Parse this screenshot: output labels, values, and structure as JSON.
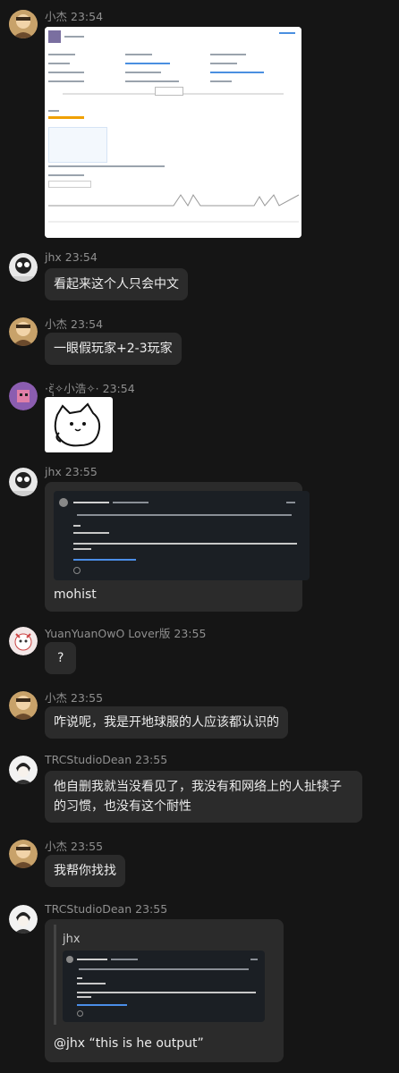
{
  "messages": [
    {
      "name": "小杰",
      "time": "23:54",
      "type": "image"
    },
    {
      "name": "jhx",
      "time": "23:54",
      "text": "看起来这个人只会中文"
    },
    {
      "name": "小杰",
      "time": "23:54",
      "text": "一眼假玩家+2-3玩家"
    },
    {
      "name": "·ὲฺฺ่✧小浩✧·",
      "time": "23:54",
      "type": "sticker"
    },
    {
      "name": "jhx",
      "time": "23:55",
      "text": "mohist",
      "type": "image-text"
    },
    {
      "name": "YuanYuanOwO Lover版",
      "time": "23:55",
      "text": "?"
    },
    {
      "name": "小杰",
      "time": "23:55",
      "text": "咋说呢，我是开地球服的人应该都认识的"
    },
    {
      "name": "TRCStudioDean",
      "time": "23:55",
      "text": "他自删我就当没看见了，我没有和网络上的人扯犊子的习惯，也没有这个耐性"
    },
    {
      "name": "小杰",
      "time": "23:55",
      "text": "我帮你找找"
    },
    {
      "name": "TRCStudioDean",
      "time": "23:55",
      "reply_to": "jhx",
      "text": "@jhx “this is he output”"
    }
  ],
  "quoted_screenshot": {
    "author": "Laoyu-king",
    "line1": "Please send me the link of the server. I would like to view all the plugins",
    "line2": "OK",
    "line3": "this is the output",
    "line4": "Mohist version 1.20.1 (CB) (API) 1.20.1 (implementing API version 1.20.1-R0.1-SNAPSHOT)"
  },
  "colors": {
    "background": "#151515",
    "bubble": "#2b2b2b",
    "meta": "#8f8f8f",
    "text": "#ececec"
  }
}
